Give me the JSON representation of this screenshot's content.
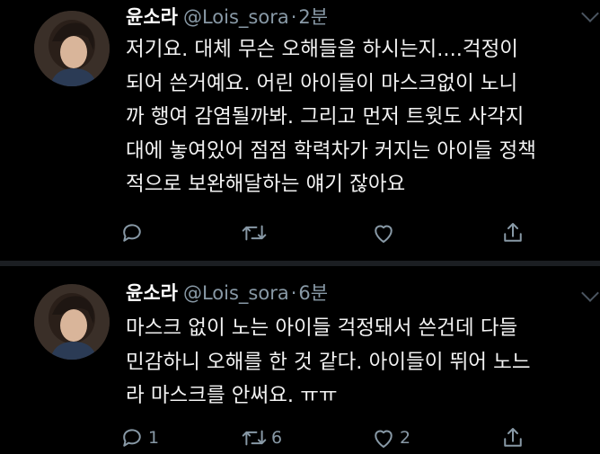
{
  "tweets": [
    {
      "name": "윤소라",
      "handle": "@Lois_sora",
      "separator": "·",
      "time": "2분",
      "lines": [
        "저기요. 대체 무슨 오해들을 하시는지....걱정이",
        "되어 쓴거예요. 어린 아이들이 마스크없이 노니",
        "까 행여 감염될까봐. 그리고 먼저 트윗도 사각지",
        "대에 놓여있어 점점 학력차가 커지는 아이들 정책",
        "적으로 보완해달하는 얘기 잖아요"
      ],
      "actions": {
        "reply_count": "",
        "retweet_count": "",
        "like_count": ""
      },
      "icons": [
        "reply-icon",
        "retweet-icon",
        "like-icon",
        "share-icon"
      ]
    },
    {
      "name": "윤소라",
      "handle": "@Lois_sora",
      "separator": "·",
      "time": "6분",
      "lines": [
        "마스크 없이 노는 아이들 걱정돼서 쓴건데 다들",
        "민감하니 오해를 한 것 같다. 아이들이 뛰어 노느",
        "라 마스크를 안써요. ㅠㅠ"
      ],
      "actions": {
        "reply_count": "1",
        "retweet_count": "6",
        "like_count": "2"
      },
      "icons": [
        "reply-icon",
        "retweet-icon",
        "like-icon",
        "share-icon"
      ]
    }
  ],
  "colors": {
    "background": "#000000",
    "text": "#f2f2f2",
    "muted": "#8899a6",
    "divider": "#1b1e22"
  }
}
